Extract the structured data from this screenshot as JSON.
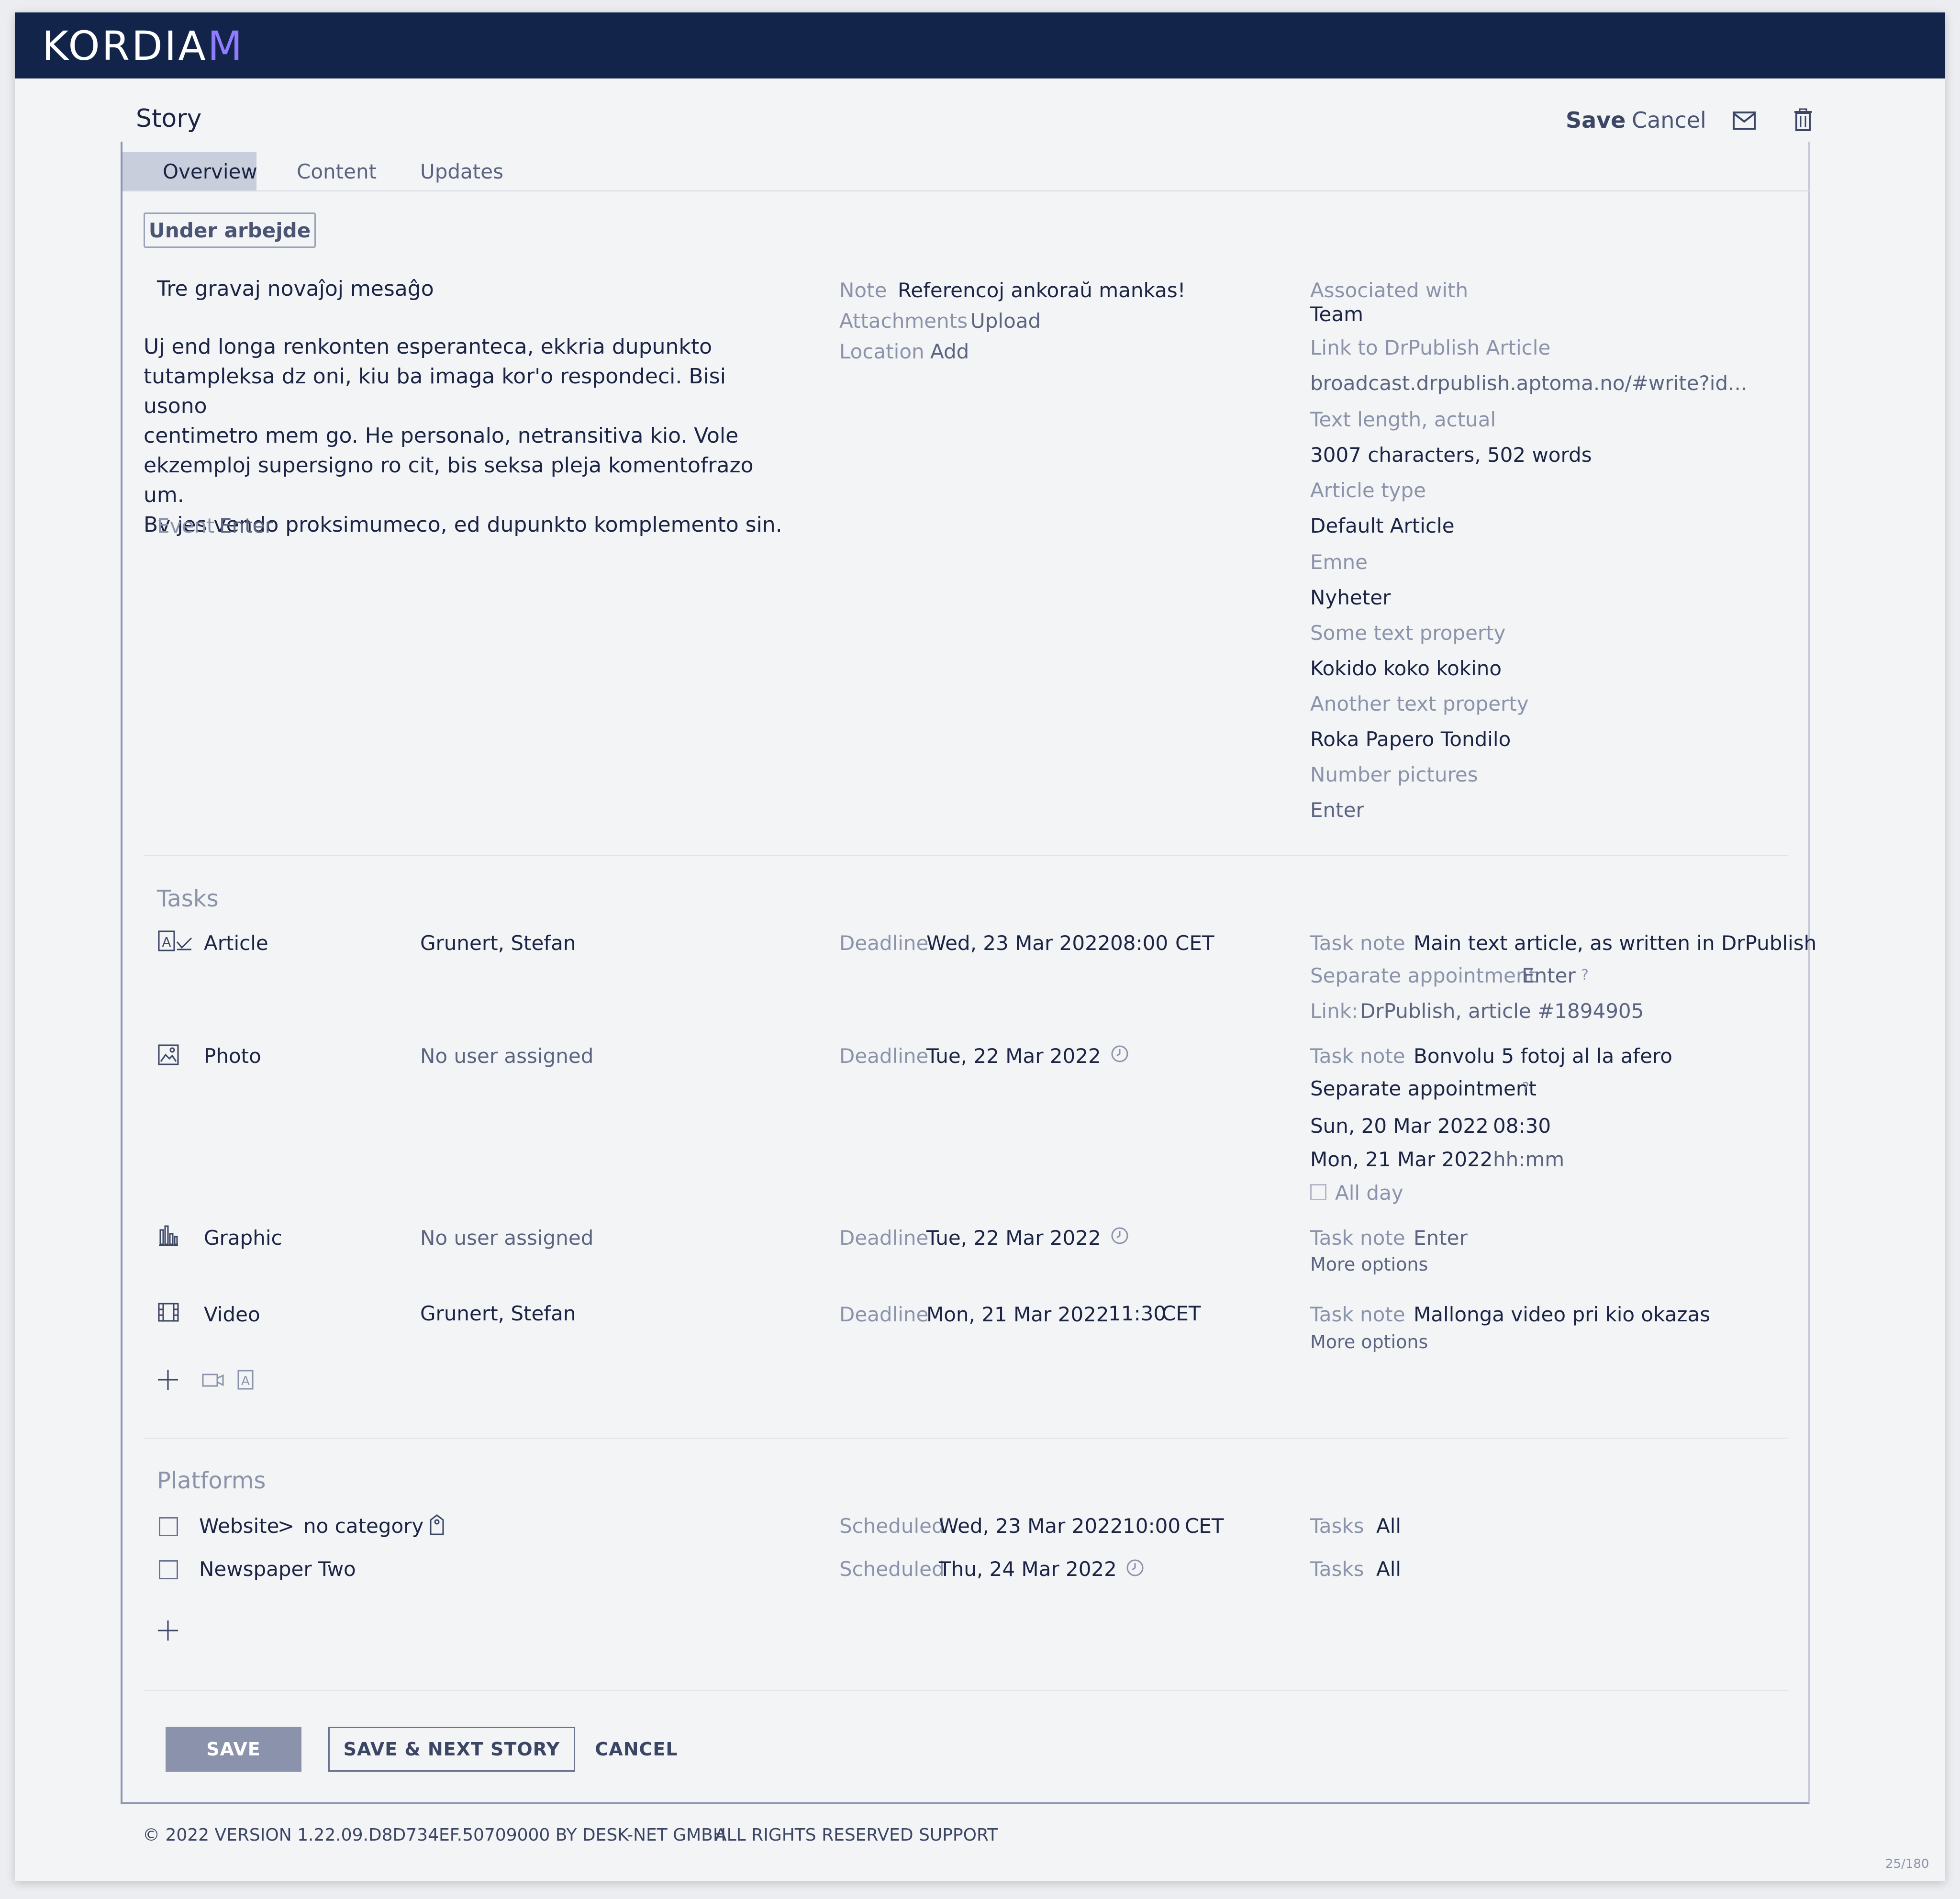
{
  "app": {
    "brand": "KORDIAM"
  },
  "header": {
    "title": "Story",
    "save": "Save",
    "cancel": "Cancel"
  },
  "tabs": [
    "Overview",
    "Content",
    "Updates"
  ],
  "status": "Under arbejde",
  "story": {
    "headline": "Tre gravaj novaĵoj mesaĝo",
    "body_lines": [
      "Uj end longa renkonten esperanteca, ekkria dupunkto",
      "tutampleksa dz oni, kiu ba imaga kor'o respondeci. Bisi usono",
      "centimetro mem go. He personalo, netransitiva kio. Vole",
      "ekzemploj supersigno ro cit, bis seksa pleja komentofrazo um.",
      "Bv jes vendo proksimumeco, ed dupunkto komplemento sin."
    ],
    "event_label": "Event",
    "event_value": "Enter"
  },
  "meta": {
    "note_label": "Note",
    "note_value": "Referencoj ankoraŭ mankas!",
    "attachments_label": "Attachments",
    "attachments_value": "Upload",
    "location_label": "Location",
    "location_value": "Add"
  },
  "properties": [
    {
      "label": "Associated with",
      "value": "Team"
    },
    {
      "label": "Link to DrPublish Article",
      "value": "broadcast.drpublish.aptoma.no/#write?id..."
    },
    {
      "label": "Text length, actual",
      "value": "3007 characters, 502 words"
    },
    {
      "label": "Article type",
      "value": "Default Article"
    },
    {
      "label": "Emne",
      "value": "Nyheter"
    },
    {
      "label": "Some text property",
      "value": "Kokido koko kokino"
    },
    {
      "label": "Another text property",
      "value": "Roka Papero Tondilo"
    },
    {
      "label": "Number pictures",
      "value": "Enter"
    }
  ],
  "tasks_title": "Tasks",
  "tasks": [
    {
      "type": "Article",
      "assignee": "Grunert, Stefan",
      "deadline_label": "Deadline",
      "date": "Wed, 23 Mar 2022",
      "time": "08:00",
      "tz": "CET",
      "note_label": "Task note",
      "note": "Main text article, as written in DrPublish",
      "sep_label": "Separate appointment",
      "sep_value": "Enter",
      "help": "?",
      "link_label": "Link:",
      "link_value": "DrPublish, article #1894905"
    },
    {
      "type": "Photo",
      "assignee": "No user assigned",
      "deadline_label": "Deadline",
      "date": "Tue, 22 Mar 2022",
      "note_label": "Task note",
      "note": "Bonvolu 5 fotoj al la afero",
      "sep_title": "Separate appointment",
      "help": "?",
      "start_date": "Sun, 20 Mar 2022",
      "start_time": "08:30",
      "end_date": "Mon, 21 Mar 2022",
      "end_time": "hh:mm",
      "all_day": "All day"
    },
    {
      "type": "Graphic",
      "assignee": "No user assigned",
      "deadline_label": "Deadline",
      "date": "Tue, 22 Mar 2022",
      "note_label": "Task note",
      "note": "Enter",
      "more": "More options"
    },
    {
      "type": "Video",
      "assignee": "Grunert, Stefan",
      "deadline_label": "Deadline",
      "date": "Mon, 21 Mar 2022",
      "time": "11:30",
      "tz": "CET",
      "note_label": "Task note",
      "note": "Mallonga video pri kio okazas",
      "more": "More options"
    }
  ],
  "platforms_title": "Platforms",
  "platforms": [
    {
      "name": "Website",
      "sep": ">",
      "category": "no category",
      "sched_label": "Scheduled",
      "date": "Wed, 23 Mar 2022",
      "time": "10:00",
      "tz": "CET",
      "tasks_label": "Tasks",
      "tasks_value": "All"
    },
    {
      "name": "Newspaper Two",
      "sched_label": "Scheduled",
      "date": "Thu, 24 Mar 2022",
      "tasks_label": "Tasks",
      "tasks_value": "All"
    }
  ],
  "buttons": {
    "save": "SAVE",
    "save_next": "SAVE & NEXT STORY",
    "cancel": "CANCEL"
  },
  "footer": {
    "copyright": "© 2022 VERSION 1.22.09.D8D734EF.50709000 BY DESK-NET GMBH",
    "rights": "ALL RIGHTS RESERVED",
    "support": "SUPPORT"
  },
  "page_counter": "25/180"
}
